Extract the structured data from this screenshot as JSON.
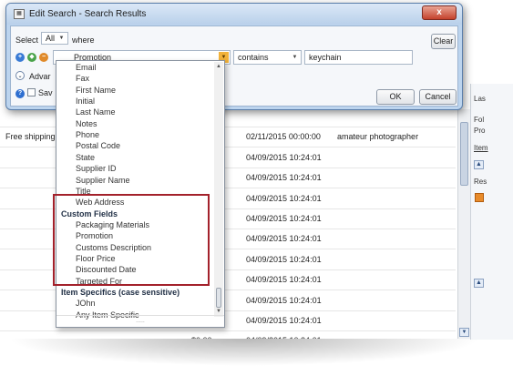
{
  "background": {
    "right_panel_labels": [
      "Las",
      "Fol",
      "Pro",
      "Item",
      "Res"
    ],
    "rows": [
      {
        "left": "",
        "date": "",
        "note": "",
        "top_cut": true
      },
      {
        "left": "Free shipping",
        "date": "02/11/2015 00:00:00",
        "note": "amateur photographer"
      },
      {
        "left": "",
        "date": "04/09/2015 10:24:01",
        "note": ""
      },
      {
        "left": "",
        "date": "04/09/2015 10:24:01",
        "note": ""
      },
      {
        "left": "",
        "date": "04/09/2015 10:24:01",
        "note": ""
      },
      {
        "left": "",
        "date": "04/09/2015 10:24:01",
        "note": ""
      },
      {
        "left": "",
        "date": "04/09/2015 10:24:01",
        "note": ""
      },
      {
        "left": "",
        "date": "04/09/2015 10:24:01",
        "note": ""
      },
      {
        "left": "",
        "date": "04/09/2015 10:24:01",
        "note": ""
      },
      {
        "left": "",
        "date": "04/09/2015 10:24:01",
        "note": ""
      },
      {
        "left": "",
        "date": "04/09/2015 10:24:01",
        "note": ""
      },
      {
        "left": "$0.00",
        "date": "04/09/2015 10:24:01",
        "note": ""
      }
    ]
  },
  "dialog": {
    "title": "Edit Search - Search Results",
    "close_label": "x",
    "select_label": "Select",
    "select_value": "All",
    "where_label": "where",
    "field_value": "Promotion",
    "operator_value": "contains",
    "search_value": "keychain",
    "clear_label": "Clear",
    "advanced_label": "Advar",
    "save_label": "Sav",
    "ok_label": "OK",
    "cancel_label": "Cancel"
  },
  "dropdown": {
    "items": [
      {
        "label": "Email",
        "group": false
      },
      {
        "label": "Fax",
        "group": false
      },
      {
        "label": "First Name",
        "group": false
      },
      {
        "label": "Initial",
        "group": false
      },
      {
        "label": "Last Name",
        "group": false
      },
      {
        "label": "Notes",
        "group": false
      },
      {
        "label": "Phone",
        "group": false
      },
      {
        "label": "Postal Code",
        "group": false
      },
      {
        "label": "State",
        "group": false
      },
      {
        "label": "Supplier ID",
        "group": false
      },
      {
        "label": "Supplier Name",
        "group": false
      },
      {
        "label": "Title",
        "group": false
      },
      {
        "label": "Web Address",
        "group": false
      },
      {
        "label": "Custom Fields",
        "group": true
      },
      {
        "label": "Packaging Materials",
        "group": false
      },
      {
        "label": "Promotion",
        "group": false
      },
      {
        "label": "Customs Description",
        "group": false
      },
      {
        "label": "Floor Price",
        "group": false
      },
      {
        "label": "Discounted Date",
        "group": false
      },
      {
        "label": "Targeted For",
        "group": false
      },
      {
        "label": "Item Specifics (case sensitive)",
        "group": true
      },
      {
        "label": "JOhn",
        "group": false
      },
      {
        "label": "Any Item Specific",
        "group": false
      }
    ]
  },
  "colors": {
    "highlight": "#a3212b",
    "dialog_frame": "#bcd4ee"
  }
}
